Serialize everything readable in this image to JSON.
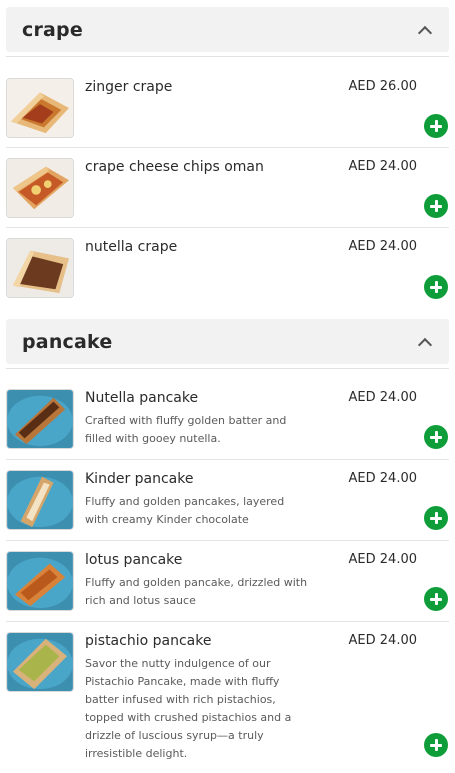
{
  "sections": [
    {
      "title": "crape",
      "items": [
        {
          "name": "zinger crape",
          "price": "AED 26.00",
          "description": "",
          "image": "zinger-crape-image"
        },
        {
          "name": "crape cheese chips oman",
          "price": "AED 24.00",
          "description": "",
          "image": "crape-cheese-chips-oman-image"
        },
        {
          "name": "nutella crape",
          "price": "AED 24.00",
          "description": "",
          "image": "nutella-crape-image"
        }
      ]
    },
    {
      "title": "pancake",
      "items": [
        {
          "name": "Nutella pancake",
          "price": "AED 24.00",
          "description": "Crafted with fluffy golden batter and filled with gooey nutella.",
          "image": "nutella-pancake-image"
        },
        {
          "name": "Kinder pancake",
          "price": "AED 24.00",
          "description": "Fluffy and golden pancakes, layered with creamy Kinder chocolate",
          "image": "kinder-pancake-image"
        },
        {
          "name": "lotus pancake",
          "price": "AED 24.00",
          "description": "Fluffy and golden pancake, drizzled with rich and lotus sauce",
          "image": "lotus-pancake-image"
        },
        {
          "name": "pistachio pancake",
          "price": "AED 24.00",
          "description": "Savor the nutty indulgence of our Pistachio Pancake, made with fluffy batter infused with rich pistachios, topped with crushed pistachios and a drizzle of luscious syrup—a truly irresistible delight.",
          "image": "pistachio-pancake-image"
        }
      ]
    }
  ],
  "icons": {
    "collapse": "chevron-up-icon",
    "add": "plus-circle-icon"
  },
  "colors": {
    "add_button": "#0f9d3a",
    "section_header_bg": "#f2f2f2",
    "divider": "#e4e4e4",
    "plate_blue": "#4aa6c9"
  }
}
